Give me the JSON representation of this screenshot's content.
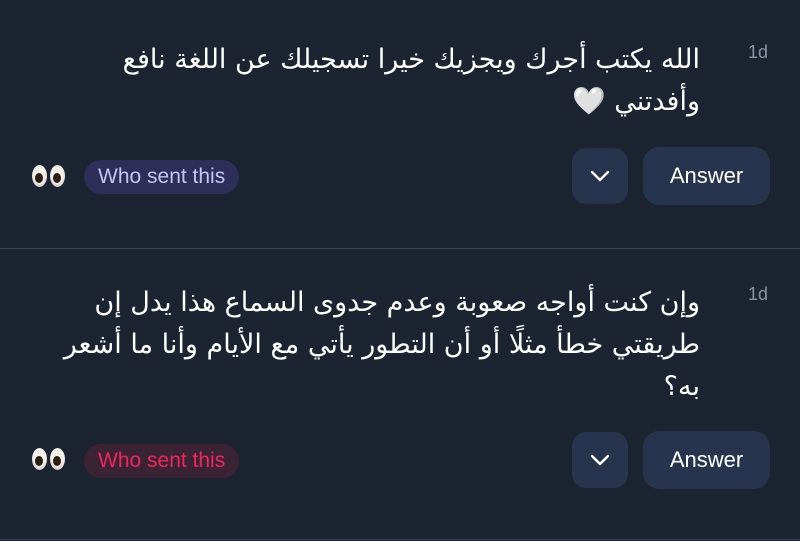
{
  "messages": [
    {
      "time": "1d",
      "lines": [
        "الله يكتب أجرك ويجزيك خيرا تسجيلك عن اللغة نافع",
        "وأفدتني 🤍"
      ],
      "reaction_icon": "eyes-emoji",
      "who_label": "Who sent this",
      "who_color": "#c7c3f2",
      "answer_label": "Answer"
    },
    {
      "time": "1d",
      "lines": [
        "وإن كنت أواجه صعوبة وعدم جدوى السماع هذا يدل إن",
        "طريقتي خطأ مثلًا أو أن التطور يأتي مع الأيام وأنا ما أشعر",
        "به؟"
      ],
      "reaction_icon": "eyes-emoji",
      "who_label": "Who sent this",
      "who_color": "#f2245c",
      "answer_label": "Answer"
    }
  ]
}
